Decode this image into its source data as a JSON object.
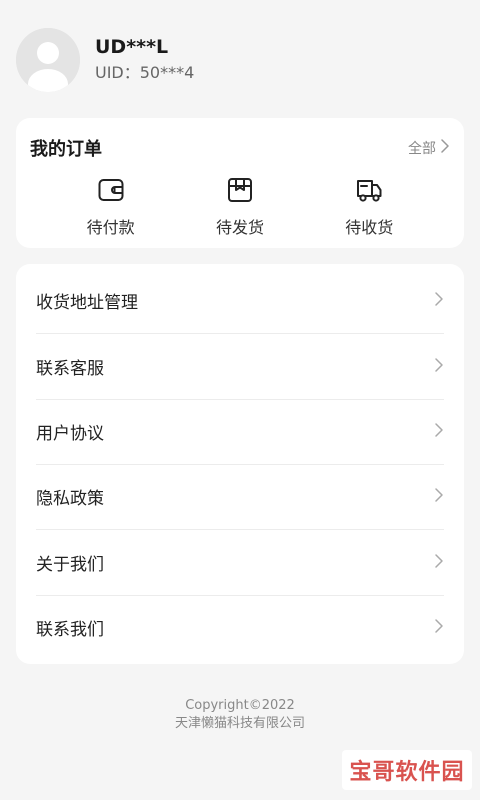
{
  "profile": {
    "name": "UD***L",
    "uid": "UID：50***4",
    "avatar_icon": "user-avatar-icon"
  },
  "orders": {
    "title": "我的订单",
    "all_label": "全部",
    "items": [
      {
        "label": "待付款",
        "icon": "wallet-icon"
      },
      {
        "label": "待发货",
        "icon": "package-icon"
      },
      {
        "label": "待收货",
        "icon": "delivery-truck-icon"
      }
    ]
  },
  "menu": {
    "items": [
      {
        "label": "收货地址管理"
      },
      {
        "label": "联系客服"
      },
      {
        "label": "用户协议"
      },
      {
        "label": "隐私政策"
      },
      {
        "label": "关于我们"
      },
      {
        "label": "联系我们"
      }
    ]
  },
  "footer": {
    "copyright": "Copyright©2022",
    "company": "天津懒猫科技有限公司"
  },
  "watermark": {
    "text": "宝哥软件园"
  },
  "colors": {
    "background": "#f5f5f5",
    "card": "#ffffff",
    "text_primary": "#222222",
    "text_secondary": "#888888",
    "watermark": "#d9534f"
  }
}
